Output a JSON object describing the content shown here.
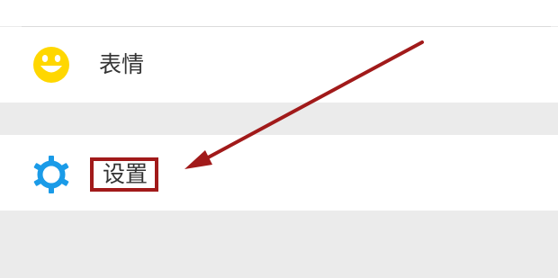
{
  "menu": {
    "items": [
      {
        "label": "表情",
        "icon": "smiley-face-icon"
      },
      {
        "label": "设置",
        "icon": "gear-icon"
      }
    ]
  },
  "colors": {
    "background": "#ebebeb",
    "row_background": "#ffffff",
    "emoji_icon": "#ffd700",
    "gear_icon": "#1a9be8",
    "annotation": "#a11a1a",
    "label_text": "#333333"
  }
}
